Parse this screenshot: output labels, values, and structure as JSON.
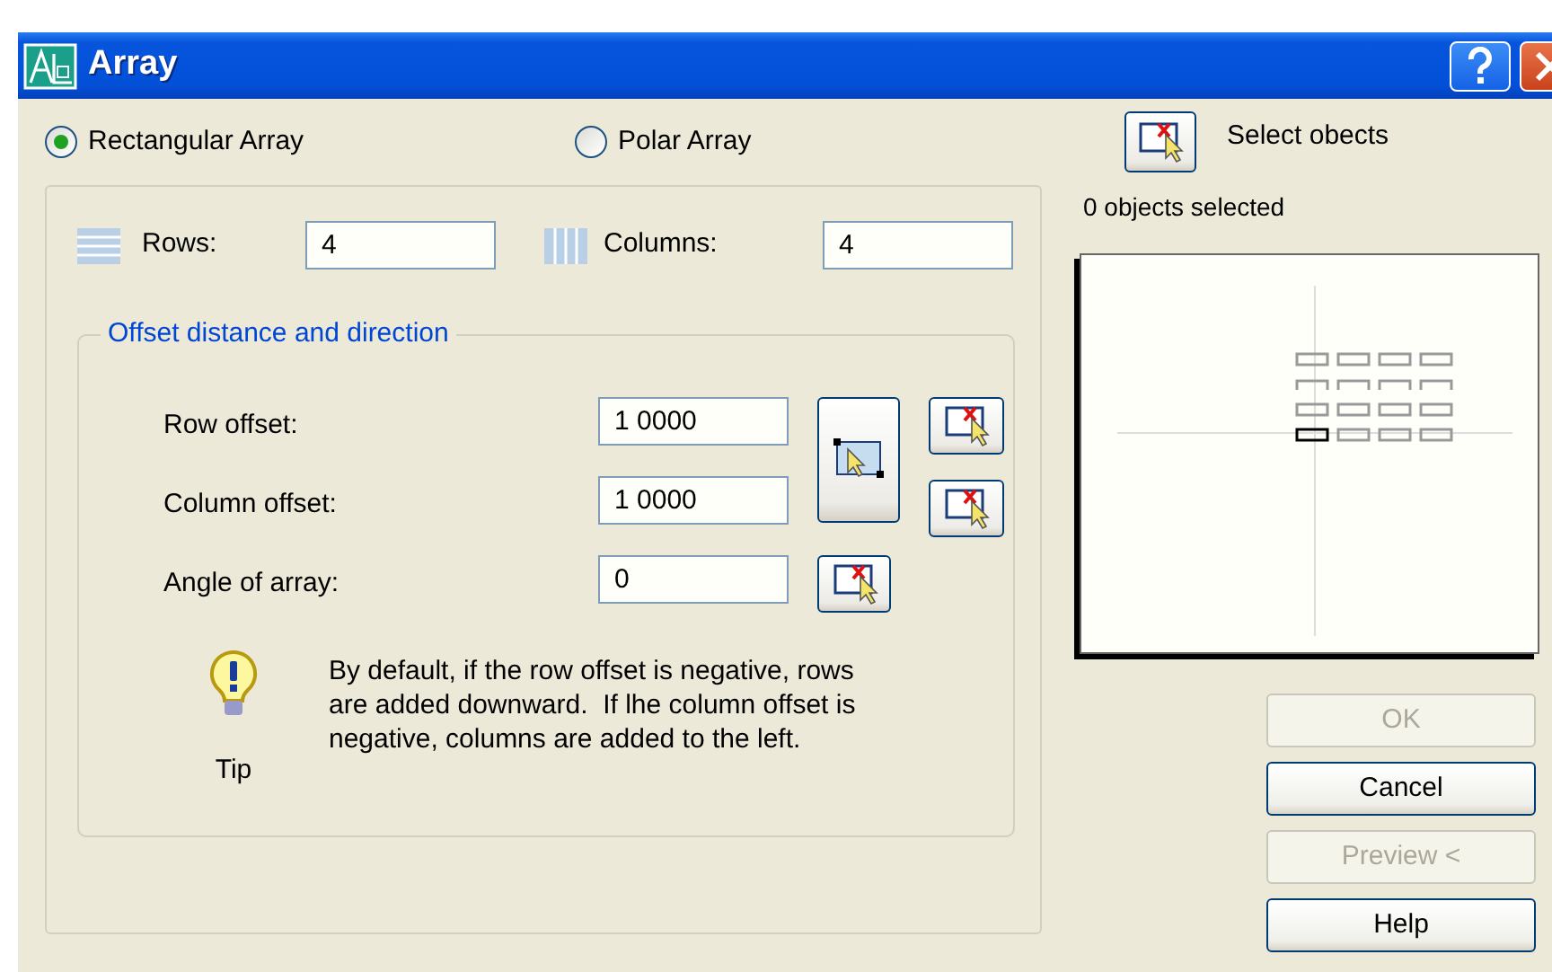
{
  "window": {
    "title": "Array"
  },
  "mode_options": [
    {
      "label": "Rectangular Array",
      "selected": true
    },
    {
      "label": "Polar Array",
      "selected": false
    }
  ],
  "select_objects": {
    "label": "Select obects",
    "selection_count": "0 objects selected"
  },
  "rows": {
    "label": "Rows:",
    "value": "4"
  },
  "columns": {
    "label": "Columns:",
    "value": "4"
  },
  "offset_group": {
    "legend": "Offset distance and direction",
    "fields": [
      {
        "label": "Row offset:",
        "value": "1 0000"
      },
      {
        "label": "Column offset:",
        "value": "1 0000"
      },
      {
        "label": "Angle of array:",
        "value": "0"
      }
    ]
  },
  "tip": {
    "label": "Tip",
    "text": "By default, if the row offset is negative, rows are added downward.  If lhe column offset is negative, columns are added to the left."
  },
  "buttons": [
    {
      "label": "OK",
      "disabled": true
    },
    {
      "label": "Cancel",
      "disabled": false
    },
    {
      "label": "Preview <",
      "disabled": true
    },
    {
      "label": "Help",
      "disabled": false
    }
  ]
}
